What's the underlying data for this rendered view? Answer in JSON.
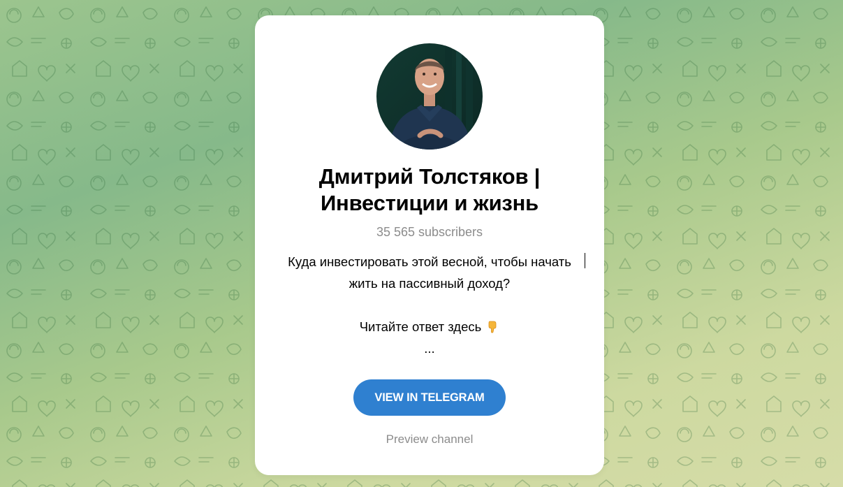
{
  "channel": {
    "title_line1": "Дмитрий Толстяков |",
    "title_line2": "Инвестиции и жизнь",
    "subscribers": "35 565 subscribers",
    "description": {
      "line1": "Куда инвестировать этой весной, чтобы начать",
      "line2": "жить на пассивный доход?",
      "line3": "Читайте ответ здесь",
      "line3_icon": "pointing-down-emoji",
      "line4": "..."
    },
    "avatar_icon": "profile-photo"
  },
  "actions": {
    "view_button": "VIEW IN TELEGRAM",
    "preview_link": "Preview channel"
  },
  "colors": {
    "button": "#2f80d0",
    "muted_text": "#8c8c8c",
    "background_start": "#86b98a",
    "background_end": "#d6dca8"
  }
}
